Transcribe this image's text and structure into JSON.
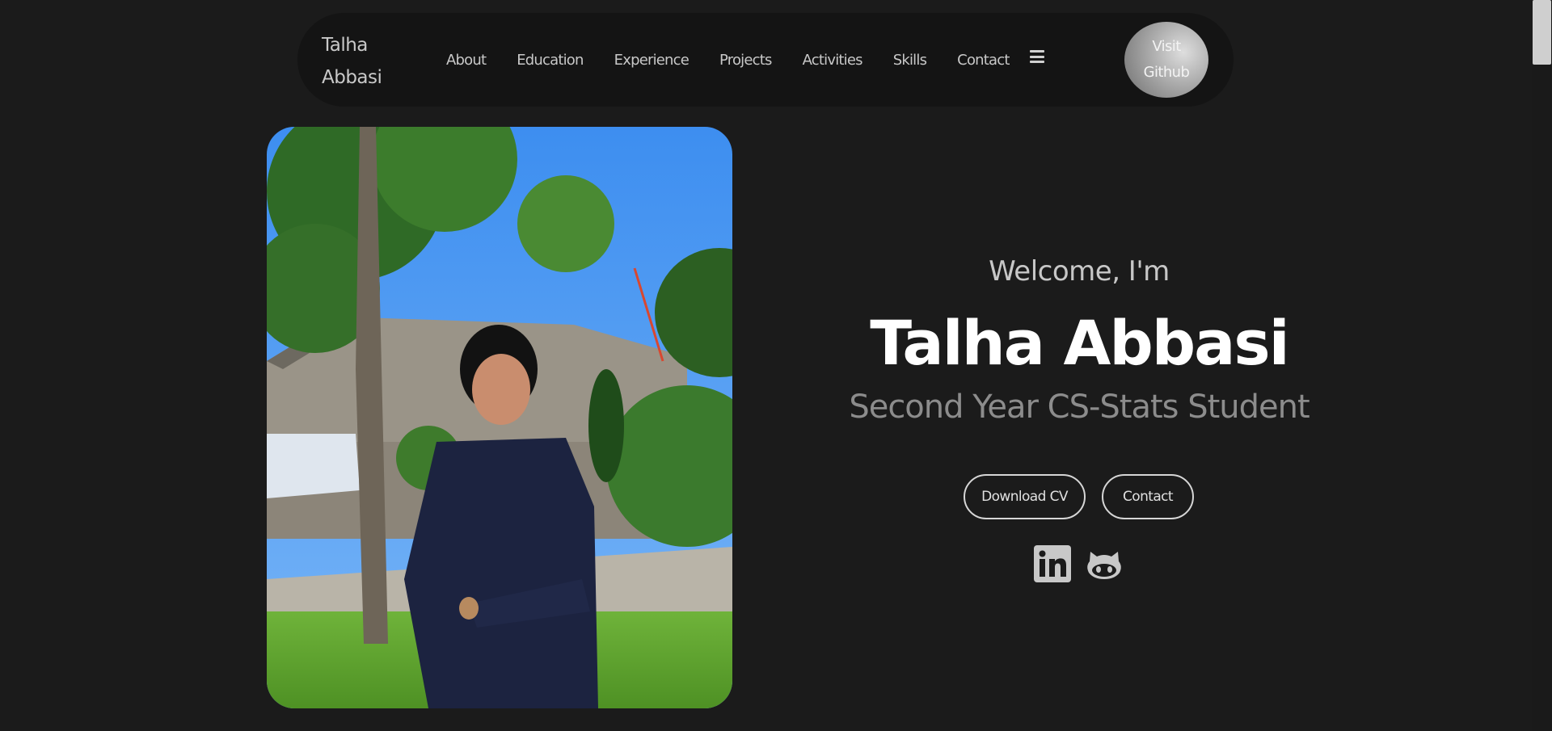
{
  "nav": {
    "brand": "Talha Abbasi",
    "links": [
      "About",
      "Education",
      "Experience",
      "Projects",
      "Activities",
      "Skills",
      "Contact"
    ],
    "menu_icon": "hamburger-icon",
    "cta": "Visit Github"
  },
  "hero": {
    "greeting": "Welcome, I'm",
    "name": "Talha Abbasi",
    "subtitle": "Second Year CS-Stats Student",
    "buttons": {
      "download_cv": "Download CV",
      "contact": "Contact"
    },
    "socials": [
      "linkedin-icon",
      "github-icon"
    ]
  },
  "colors": {
    "background": "#1b1b1b",
    "navbar": "#141414",
    "text_primary": "#ffffff",
    "text_muted": "#8c8c8c"
  }
}
